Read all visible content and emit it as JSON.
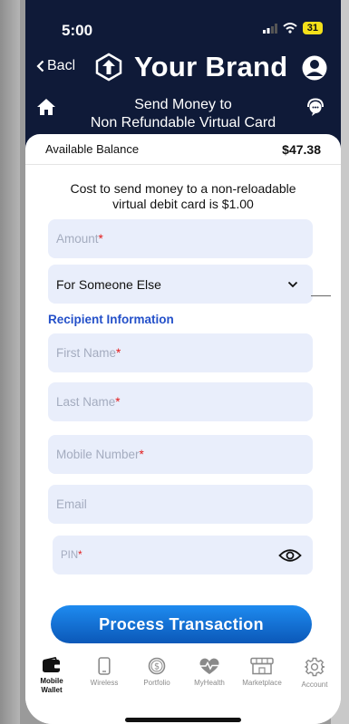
{
  "status": {
    "time": "5:00",
    "battery": "31"
  },
  "header": {
    "back_label": "Back",
    "brand_name": "Your Brand",
    "title_line1": "Send Money to",
    "title_line2": "Non Refundable Virtual Card"
  },
  "balance": {
    "label": "Available Balance",
    "value": "$47.38"
  },
  "notice": "Cost to send money to a non-reloadable virtual debit card is $1.00",
  "form": {
    "amount": {
      "placeholder": "Amount",
      "required": "*"
    },
    "recipient_type": {
      "selected": "For Someone Else"
    },
    "section_label": "Recipient Information",
    "first_name": {
      "placeholder": "First Name",
      "required": "*"
    },
    "last_name": {
      "placeholder": "Last Name",
      "required": "*"
    },
    "mobile": {
      "placeholder": "Mobile Number",
      "required": "*"
    },
    "email": {
      "placeholder": "Email"
    },
    "pin": {
      "placeholder": "PIN",
      "required": "*"
    },
    "submit_label": "Process Transaction"
  },
  "tabs": [
    {
      "label_line1": "Mobile",
      "label_line2": "Wallet",
      "icon": "wallet-icon",
      "active": true
    },
    {
      "label_line1": "Wireless",
      "label_line2": "",
      "icon": "phone-icon",
      "active": false
    },
    {
      "label_line1": "Portfolio",
      "label_line2": "",
      "icon": "dollar-coin-icon",
      "active": false
    },
    {
      "label_line1": "MyHealth",
      "label_line2": "",
      "icon": "heart-pulse-icon",
      "active": false
    },
    {
      "label_line1": "Marketplace",
      "label_line2": "",
      "icon": "store-icon",
      "active": false
    },
    {
      "label_line1": "Account",
      "label_line2": "",
      "icon": "gear-icon",
      "active": false
    }
  ],
  "colors": {
    "header_bg": "#0f1a38",
    "field_bg": "#e9eefb",
    "accent": "#2450c9",
    "button": "#1176dd",
    "required": "#e21b1b"
  }
}
